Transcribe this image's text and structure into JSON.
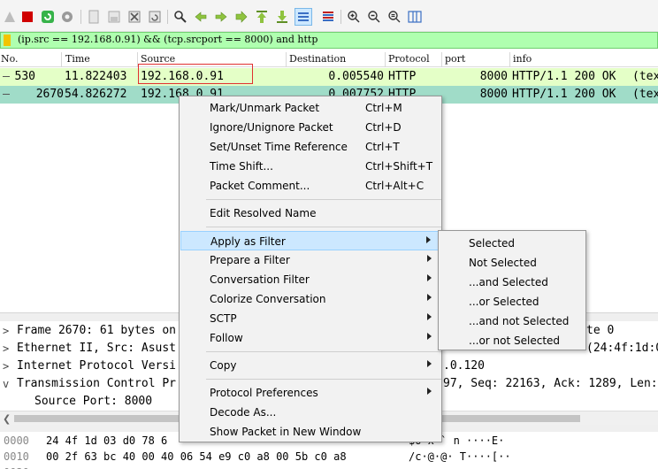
{
  "toolbar": {
    "icons": [
      "shark-fin-start-icon",
      "stop-capture-icon",
      "restart-capture-icon",
      "capture-options-icon",
      "open-file-icon",
      "save-file-icon",
      "close-file-icon",
      "reload-file-icon",
      "find-packet-icon",
      "go-back-icon",
      "go-forward-icon",
      "go-to-packet-icon",
      "go-first-icon",
      "go-last-icon",
      "auto-scroll-icon",
      "colorize-icon",
      "zoom-in-icon",
      "zoom-out-icon",
      "normal-size-icon",
      "resize-columns-icon"
    ]
  },
  "filter": {
    "text": "(ip.src == 192.168.0.91) && (tcp.srcport == 8000) and http"
  },
  "packet_list": {
    "columns": [
      "No.",
      "Time",
      "Source",
      "Destination",
      "Protocol",
      "port",
      "info"
    ],
    "rows": [
      {
        "no": "530",
        "time": "11.822403",
        "source": "192.168.0.91",
        "destination": "0.005540",
        "protocol": "HTTP",
        "port": "8000",
        "info": "HTTP/1.1 200 OK",
        "extra": "(tex"
      },
      {
        "no": "2670",
        "time": "54.826272",
        "source": "192.168.0.91",
        "destination": "0.007752",
        "protocol": "HTTP",
        "port": "8000",
        "info": "HTTP/1.1 200 OK",
        "extra": "(tex"
      }
    ]
  },
  "details": {
    "rows": [
      {
        "arrow": ">",
        "text": "Frame 2670: 61 bytes on",
        "tail": "te 0"
      },
      {
        "arrow": ">",
        "text": "Ethernet II, Src: Asust",
        "tail": "(24:4f:1d:0"
      },
      {
        "arrow": ">",
        "text": "Internet Protocol Versi",
        "tail": ".0.120"
      },
      {
        "arrow": "v",
        "text": "Transmission Control Pr",
        "tail": "97, Seq: 22163, Ack: 1289, Len:"
      },
      {
        "arrow": "",
        "text": "Source Port: 8000",
        "tail": ""
      }
    ]
  },
  "bytes": {
    "rows": [
      {
        "offset": "0000",
        "hex": "24 4f 1d 03 d0 78 6",
        "ascii": "$O x `  n ····E·"
      },
      {
        "offset": "0010",
        "hex": "00 2f 63 bc 40 00 40 06   54 e9 c0 a8 00 5b c0 a8",
        "ascii": "/c·@·@· T····[··"
      },
      {
        "offset": "0020",
        "hex": "",
        "ascii": ""
      }
    ]
  },
  "context_menu": {
    "items": [
      {
        "label": "Mark/Unmark Packet",
        "shortcut": "Ctrl+M"
      },
      {
        "label": "Ignore/Unignore Packet",
        "shortcut": "Ctrl+D"
      },
      {
        "label": "Set/Unset Time Reference",
        "shortcut": "Ctrl+T"
      },
      {
        "label": "Time Shift...",
        "shortcut": "Ctrl+Shift+T"
      },
      {
        "label": "Packet Comment...",
        "shortcut": "Ctrl+Alt+C"
      },
      {
        "label": "Edit Resolved Name",
        "shortcut": ""
      },
      {
        "label": "Apply as Filter",
        "shortcut": ""
      },
      {
        "label": "Prepare a Filter",
        "shortcut": ""
      },
      {
        "label": "Conversation Filter",
        "shortcut": ""
      },
      {
        "label": "Colorize Conversation",
        "shortcut": ""
      },
      {
        "label": "SCTP",
        "shortcut": ""
      },
      {
        "label": "Follow",
        "shortcut": ""
      },
      {
        "label": "Copy",
        "shortcut": ""
      },
      {
        "label": "Protocol Preferences",
        "shortcut": ""
      },
      {
        "label": "Decode As...",
        "shortcut": ""
      },
      {
        "label": "Show Packet in New Window",
        "shortcut": ""
      }
    ]
  },
  "submenu": {
    "items": [
      "Selected",
      "Not Selected",
      "...and Selected",
      "...or Selected",
      "...and not Selected",
      "...or not Selected"
    ]
  },
  "colors": {
    "filter_bg": "#afffaf",
    "row1_bg": "#e4ffc7",
    "row2_bg": "#a0dcc8",
    "highlight": "#cce8ff",
    "source_box": "#e03030"
  }
}
